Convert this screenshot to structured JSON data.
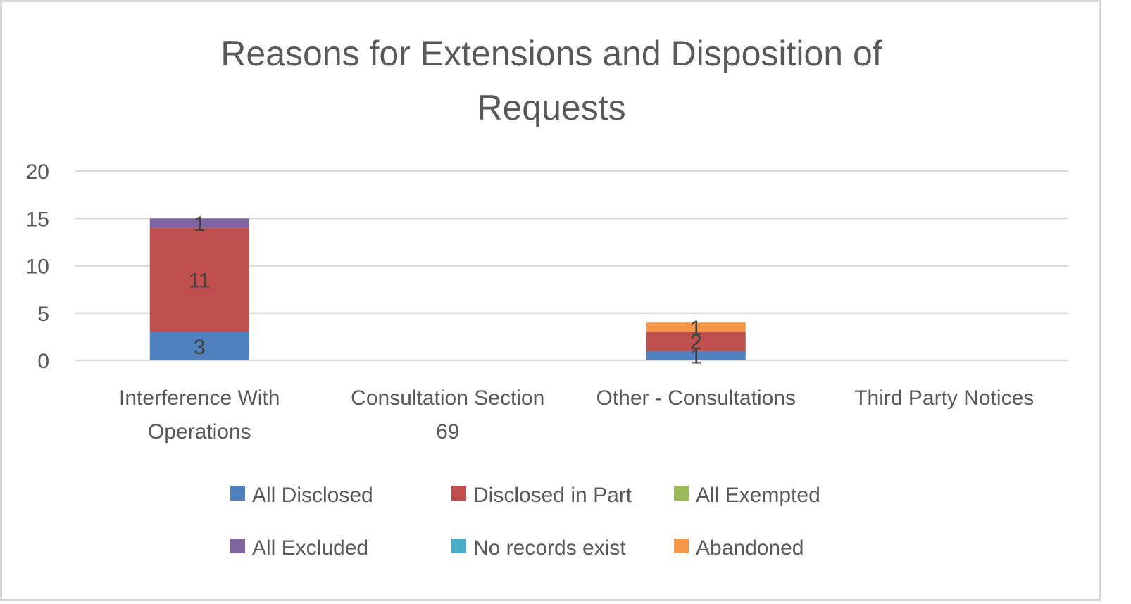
{
  "chart_data": {
    "type": "bar",
    "stacked": true,
    "title": "Reasons for Extensions and Disposition of Requests",
    "title_lines": [
      "Reasons for Extensions and Disposition of",
      "Requests"
    ],
    "xlabel": "",
    "ylabel": "",
    "ylim": [
      0,
      20
    ],
    "yticks": [
      0,
      5,
      10,
      15,
      20
    ],
    "grid": true,
    "legend_position": "bottom",
    "categories": [
      [
        "Interference With",
        "Operations"
      ],
      [
        "Consultation Section",
        "69"
      ],
      [
        "Other - Consultations"
      ],
      [
        "Third Party Notices"
      ]
    ],
    "category_names": [
      "Interference With Operations",
      "Consultation Section 69",
      "Other - Consultations",
      "Third Party Notices"
    ],
    "series": [
      {
        "name": "All Disclosed",
        "color": "#4f81bd",
        "values": [
          3,
          0,
          1,
          0
        ]
      },
      {
        "name": "Disclosed in Part",
        "color": "#c0504d",
        "values": [
          11,
          0,
          2,
          0
        ]
      },
      {
        "name": "All Exempted",
        "color": "#9bbb59",
        "values": [
          0,
          0,
          0,
          0
        ]
      },
      {
        "name": "All Excluded",
        "color": "#8064a2",
        "values": [
          1,
          0,
          0,
          0
        ]
      },
      {
        "name": "No records exist",
        "color": "#4bacc6",
        "values": [
          0,
          0,
          0,
          0
        ]
      },
      {
        "name": "Abandoned",
        "color": "#f79646",
        "values": [
          0,
          0,
          1,
          0
        ]
      }
    ]
  }
}
